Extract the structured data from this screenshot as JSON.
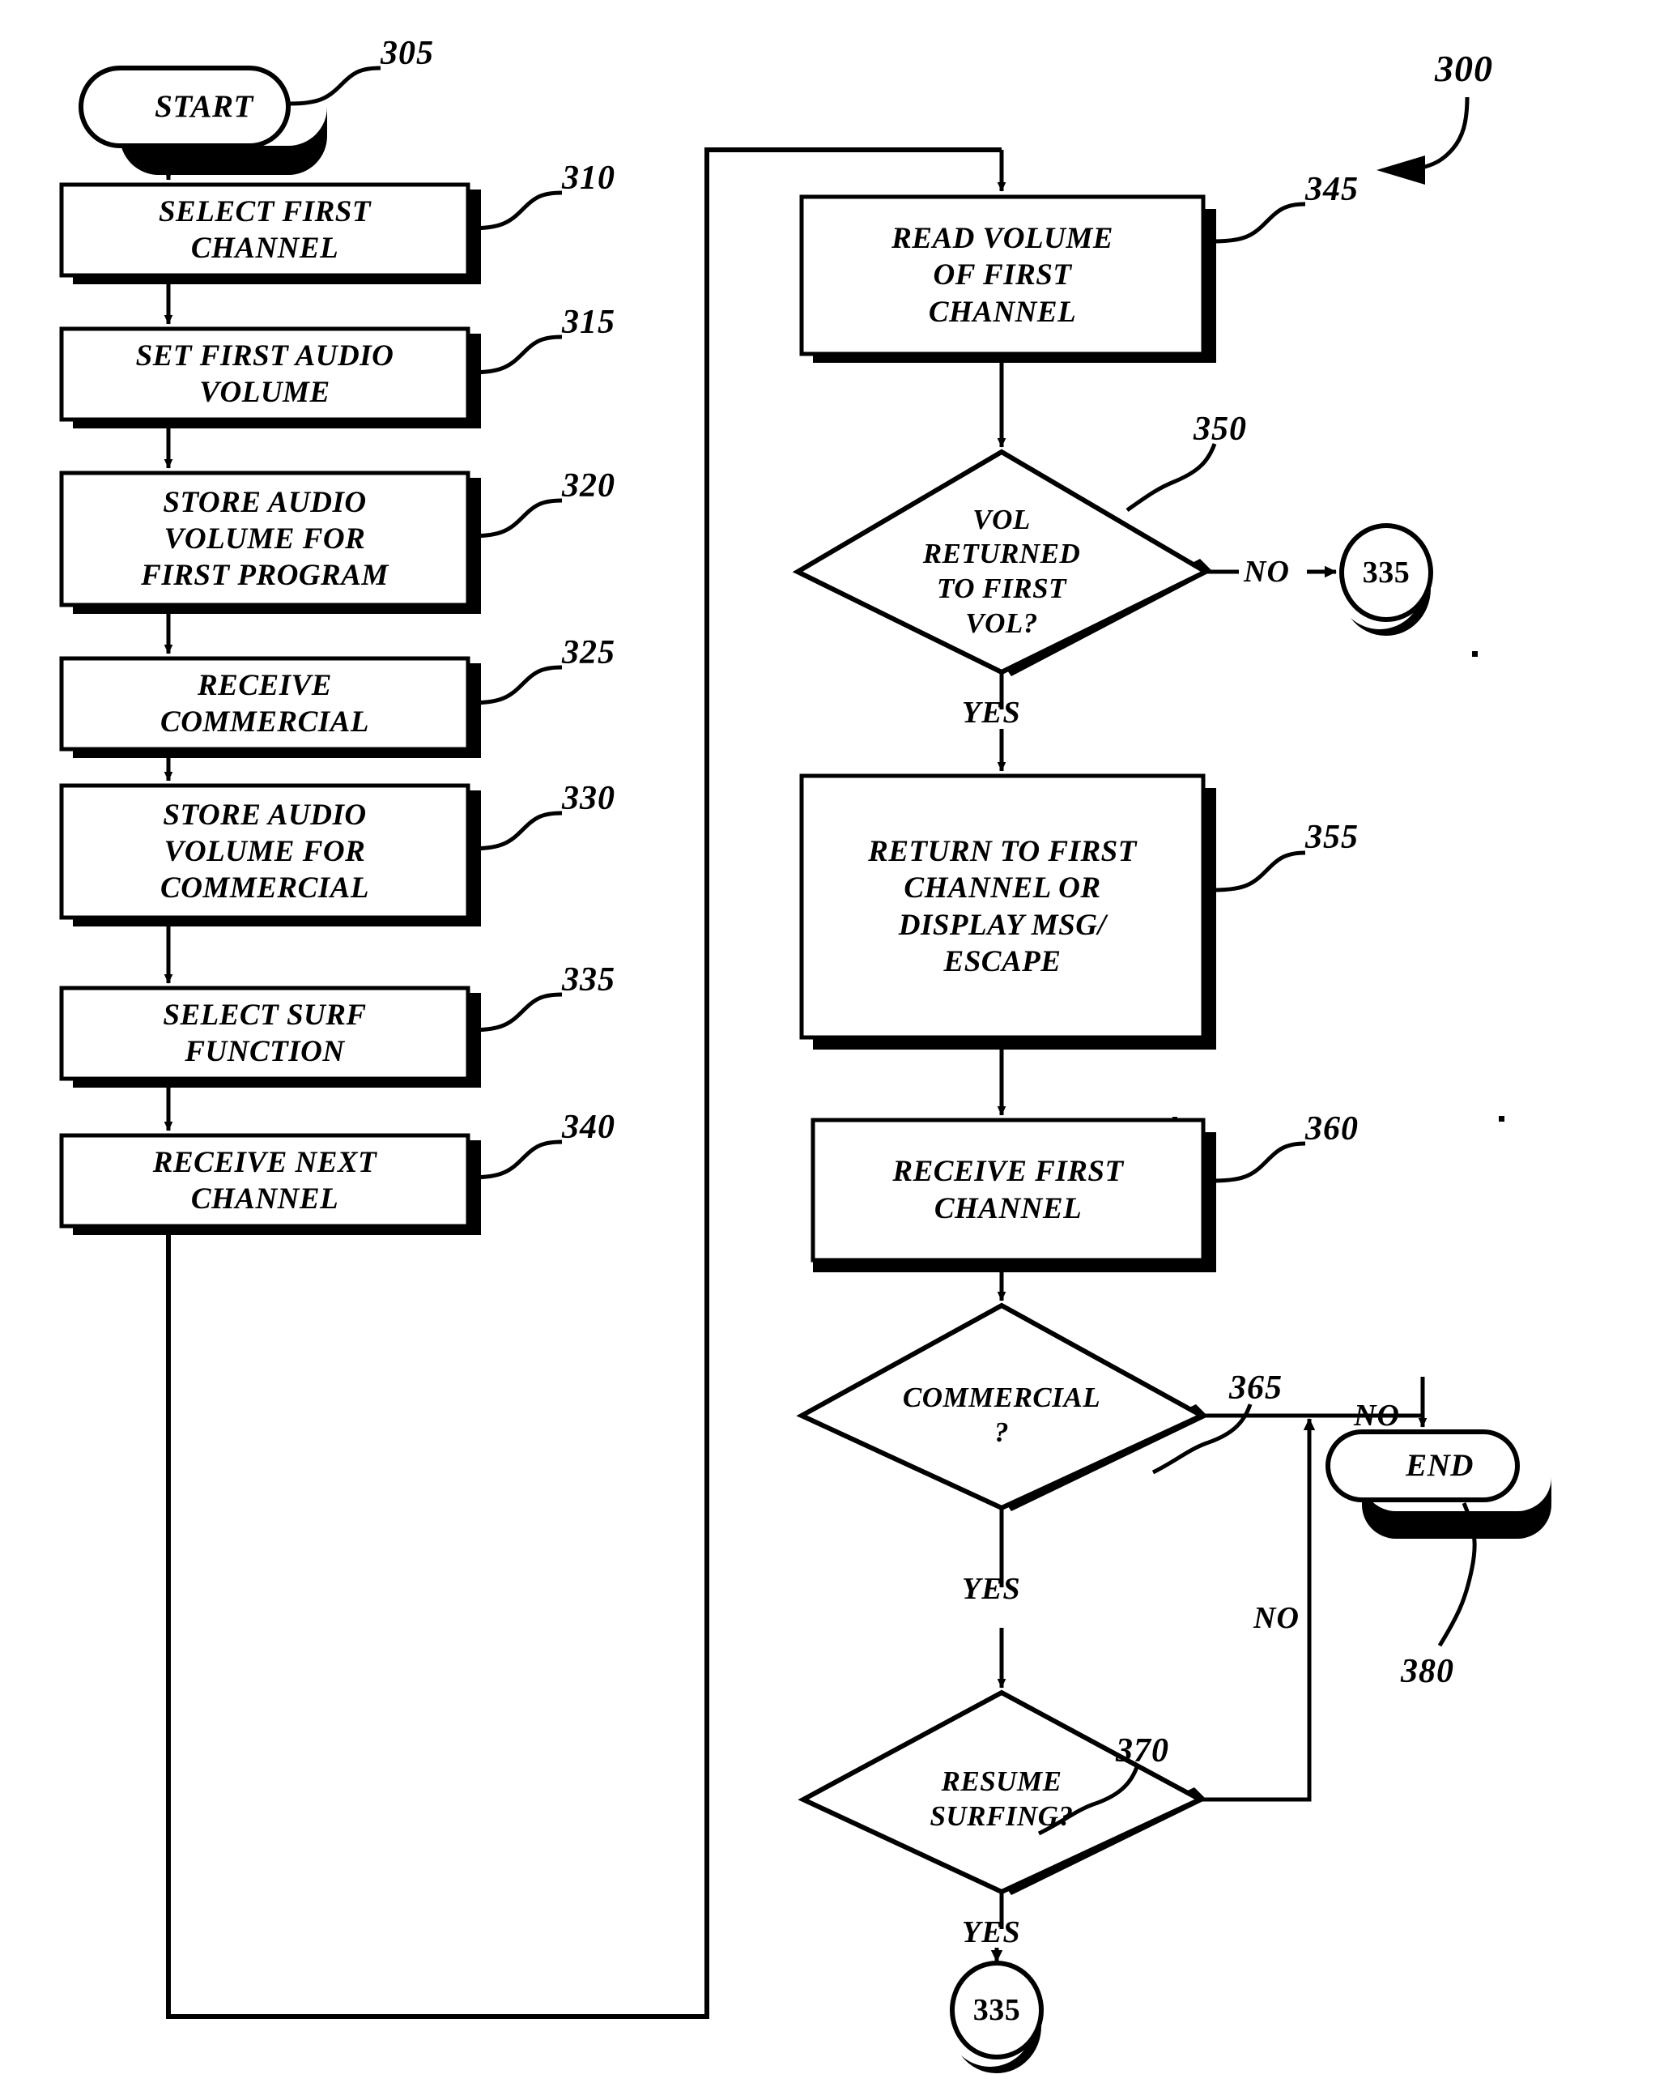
{
  "figure": {
    "id_label": "300",
    "type": "patent-flowchart"
  },
  "nodes": {
    "start": {
      "label": "START",
      "ref": "305",
      "shape": "terminator"
    },
    "n310": {
      "label": "SELECT FIRST\nCHANNEL",
      "ref": "310",
      "shape": "process"
    },
    "n315": {
      "label": "SET FIRST AUDIO\nVOLUME",
      "ref": "315",
      "shape": "process"
    },
    "n320": {
      "label": "STORE AUDIO\nVOLUME FOR\nFIRST PROGRAM",
      "ref": "320",
      "shape": "process"
    },
    "n325": {
      "label": "RECEIVE\nCOMMERCIAL",
      "ref": "325",
      "shape": "process"
    },
    "n330": {
      "label": "STORE AUDIO\nVOLUME FOR\nCOMMERCIAL",
      "ref": "330",
      "shape": "process"
    },
    "n335": {
      "label": "SELECT SURF\nFUNCTION",
      "ref": "335",
      "shape": "process"
    },
    "n340": {
      "label": "RECEIVE NEXT\nCHANNEL",
      "ref": "340",
      "shape": "process"
    },
    "n345": {
      "label": "READ VOLUME\nOF FIRST\nCHANNEL",
      "ref": "345",
      "shape": "process"
    },
    "n350": {
      "label": "VOL\nRETURNED\nTO FIRST\nVOL?",
      "ref": "350",
      "shape": "decision"
    },
    "n355": {
      "label": "RETURN TO FIRST\nCHANNEL OR\nDISPLAY MSG/\nESCAPE",
      "ref": "355",
      "shape": "process"
    },
    "n360": {
      "label": "RECEIVE FIRST\nCHANNEL",
      "ref": "360",
      "shape": "process"
    },
    "n365": {
      "label": "COMMERCIAL\n?",
      "ref": "365",
      "shape": "decision"
    },
    "n370": {
      "label": "RESUME\nSURFING?",
      "ref": "370",
      "shape": "decision"
    },
    "end": {
      "label": "END",
      "ref": "380",
      "shape": "terminator"
    },
    "conn_top": {
      "label": "335",
      "shape": "connector"
    },
    "conn_bottom": {
      "label": "335",
      "shape": "connector"
    }
  },
  "edge_labels": {
    "d350_no": "NO",
    "d350_yes": "YES",
    "d365_no": "NO",
    "d365_yes": "YES",
    "d370_no": "NO",
    "d370_yes": "YES"
  },
  "colors": {
    "line": "#000000",
    "fill": "#ffffff",
    "shadow": "#000000"
  }
}
